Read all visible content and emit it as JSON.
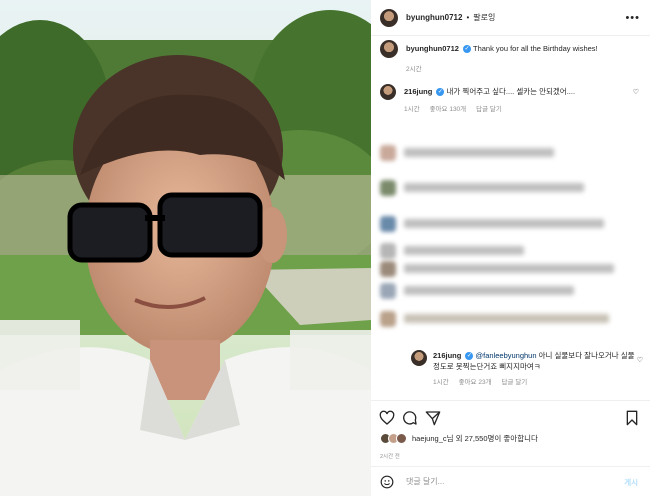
{
  "header": {
    "username": "byunghun0712",
    "follow_label": "팔로잉",
    "more_icon": "more-horizontal-icon"
  },
  "caption": {
    "username": "byunghun0712",
    "text": "Thank you for all the Birthday wishes!",
    "time": "2시간"
  },
  "comments": [
    {
      "username": "216jung",
      "text": "내가 찍어주고 싶다.... 셀카는 안되겠어....",
      "time": "1시간",
      "likes": "좋아요 130개",
      "reply_label": "답글 달기"
    }
  ],
  "blurred_comments": 7,
  "reply": {
    "username": "216jung",
    "mention": "@fanleebyunghun",
    "text": " 아니 실물보다 잘나오거나 실물정도로 못찍는단거죠 삐지지마여ㅋ",
    "time": "1시간",
    "likes": "좋아요 23개",
    "reply_label": "답글 달기"
  },
  "likes_summary": {
    "text": "haejung_c님 외 27,550명이 좋아합니다"
  },
  "post_time": "2시간 전",
  "comment_input": {
    "placeholder": "댓글 달기...",
    "post_label": "게시"
  },
  "colors": {
    "verified": "#3897f0",
    "link": "#00376b",
    "post_button_disabled": "#b2dffc"
  }
}
